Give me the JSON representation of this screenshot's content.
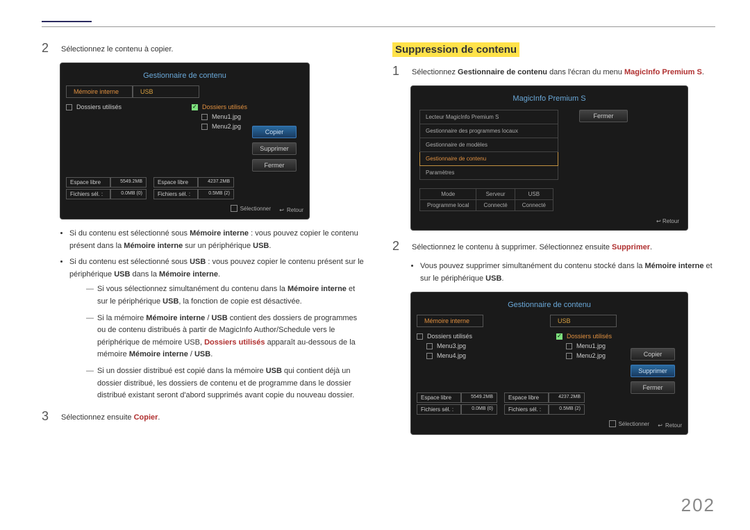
{
  "page_number": "202",
  "left": {
    "step2": "Sélectionnez le contenu à copier.",
    "panel1": {
      "title": "Gestionnaire de contenu",
      "tab_internal": "Mémoire interne",
      "tab_usb": "USB",
      "row_folders": "Dossiers utilisés",
      "row_folders2": "Dossiers utilisés",
      "row_file1": "Menu1.jpg",
      "row_file2": "Menu2.jpg",
      "btn_copy": "Copier",
      "btn_delete": "Supprimer",
      "btn_close": "Fermer",
      "stat_free": "Espace libre",
      "stat_free_v1": "5549.2MB",
      "stat_free_v2": "4237.2MB",
      "stat_sel": "Fichiers sél. :",
      "stat_sel_v1": "0.0MB (0)",
      "stat_sel_v2": "0.5MB (2)",
      "foot_select": "Sélectionner",
      "foot_return": "Retour"
    },
    "bullet1_a": "Si du contenu est sélectionné sous ",
    "bullet1_b": "Mémoire interne",
    "bullet1_c": " : vous pouvez copier le contenu présent dans la ",
    "bullet1_d": "Mémoire interne",
    "bullet1_e": " sur un périphérique ",
    "bullet1_f": "USB",
    "bullet1_g": ".",
    "bullet2_a": "Si du contenu est sélectionné sous ",
    "bullet2_b": "USB",
    "bullet2_c": " : vous pouvez copier le contenu présent sur le périphérique ",
    "bullet2_d": "USB",
    "bullet2_e": " dans la ",
    "bullet2_f": "Mémoire interne",
    "bullet2_g": ".",
    "sub1_a": "Si vous sélectionnez simultanément du contenu dans la ",
    "sub1_b": "Mémoire interne",
    "sub1_c": " et sur le périphérique ",
    "sub1_d": "USB",
    "sub1_e": ", la fonction de copie est désactivée.",
    "sub2_a": "Si la mémoire ",
    "sub2_b": "Mémoire interne",
    "sub2_c": " / ",
    "sub2_d": "USB",
    "sub2_e": " contient des dossiers de programmes ou de contenu distribués à partir de MagicInfo Author/Schedule vers le périphérique de mémoire USB, ",
    "sub2_f": "Dossiers utilisés",
    "sub2_g": " apparaît au-dessous de la mémoire ",
    "sub2_h": "Mémoire interne",
    "sub2_i": " / ",
    "sub2_j": "USB",
    "sub2_k": ".",
    "sub3_a": "Si un dossier distribué est copié dans la mémoire ",
    "sub3_b": "USB",
    "sub3_c": " qui contient déjà un dossier distribué, les dossiers de contenu et de programme dans le dossier distribué existant seront d'abord supprimés avant copie du nouveau dossier.",
    "step3_a": "Sélectionnez ensuite ",
    "step3_b": "Copier",
    "step3_c": "."
  },
  "right": {
    "heading": "Suppression de contenu",
    "step1_a": "Sélectionnez ",
    "step1_b": "Gestionnaire de contenu",
    "step1_c": " dans l'écran du menu ",
    "step1_d": "MagicInfo Premium S",
    "step1_e": ".",
    "menuPanel": {
      "title": "MagicInfo Premium S",
      "item1": "Lecteur MagicInfo Premium S",
      "item2": "Gestionnaire des programmes locaux",
      "item3": "Gestionnaire de modèles",
      "item4": "Gestionnaire de contenu",
      "item5": "Paramètres",
      "btn_close": "Fermer",
      "th_mode": "Mode",
      "th_server": "Serveur",
      "th_usb": "USB",
      "td_prog": "Programme local",
      "td_conn1": "Connecté",
      "td_conn2": "Connecté",
      "foot_return": "Retour"
    },
    "step2_a": "Sélectionnez le contenu à supprimer. Sélectionnez ensuite ",
    "step2_b": "Supprimer",
    "step2_c": ".",
    "bullet_a": "Vous pouvez supprimer simultanément du contenu stocké dans la ",
    "bullet_b": "Mémoire interne",
    "bullet_c": " et sur le périphérique ",
    "bullet_d": "USB",
    "bullet_e": ".",
    "panel2": {
      "title": "Gestionnaire de contenu",
      "tab_internal": "Mémoire interne",
      "tab_usb": "USB",
      "l_folders": "Dossiers utilisés",
      "l_file1": "Menu3.jpg",
      "l_file2": "Menu4.jpg",
      "r_folders": "Dossiers utilisés",
      "r_file1": "Menu1.jpg",
      "r_file2": "Menu2.jpg",
      "btn_copy": "Copier",
      "btn_delete": "Supprimer",
      "btn_close": "Fermer",
      "stat_free": "Espace libre",
      "stat_free_v1": "5549.2MB",
      "stat_free_v2": "4237.2MB",
      "stat_sel": "Fichiers sél. :",
      "stat_sel_v1": "0.0MB (0)",
      "stat_sel_v2": "0.5MB (2)",
      "foot_select": "Sélectionner",
      "foot_return": "Retour"
    }
  }
}
